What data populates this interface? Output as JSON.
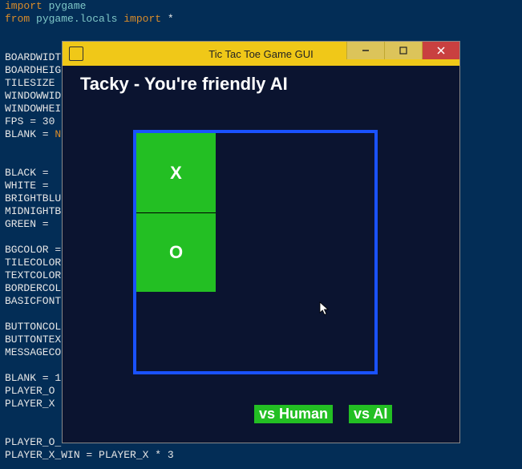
{
  "code_lines": [
    {
      "spans": [
        {
          "t": "import",
          "c": "kw-orange"
        },
        {
          "t": " pygame",
          "c": "kw-cyan"
        }
      ]
    },
    {
      "spans": [
        {
          "t": "from",
          "c": "kw-orange"
        },
        {
          "t": " pygame.locals ",
          "c": "kw-cyan"
        },
        {
          "t": "import",
          "c": "kw-orange"
        },
        {
          "t": " *",
          "c": "kw-white"
        }
      ]
    },
    {
      "spans": []
    },
    {
      "spans": []
    },
    {
      "spans": [
        {
          "t": "BOARDWIDT",
          "c": "kw-white"
        }
      ]
    },
    {
      "spans": [
        {
          "t": "BOARDHEIG",
          "c": "kw-white"
        }
      ]
    },
    {
      "spans": [
        {
          "t": "TILESIZE ",
          "c": "kw-white"
        }
      ]
    },
    {
      "spans": [
        {
          "t": "WINDOWWID",
          "c": "kw-white"
        }
      ]
    },
    {
      "spans": [
        {
          "t": "WINDOWHEI",
          "c": "kw-white"
        }
      ]
    },
    {
      "spans": [
        {
          "t": "FPS = 30",
          "c": "kw-white"
        }
      ]
    },
    {
      "spans": [
        {
          "t": "BLANK = ",
          "c": "kw-white"
        },
        {
          "t": "N",
          "c": "kw-orange"
        }
      ]
    },
    {
      "spans": []
    },
    {
      "spans": []
    },
    {
      "spans": [
        {
          "t": "BLACK = ",
          "c": "kw-white"
        }
      ]
    },
    {
      "spans": [
        {
          "t": "WHITE = ",
          "c": "kw-white"
        }
      ]
    },
    {
      "spans": [
        {
          "t": "BRIGHTBLU",
          "c": "kw-white"
        }
      ]
    },
    {
      "spans": [
        {
          "t": "MIDNIGHTB",
          "c": "kw-white"
        }
      ]
    },
    {
      "spans": [
        {
          "t": "GREEN = ",
          "c": "kw-white"
        }
      ]
    },
    {
      "spans": []
    },
    {
      "spans": [
        {
          "t": "BGCOLOR =",
          "c": "kw-white"
        }
      ]
    },
    {
      "spans": [
        {
          "t": "TILECOLOR",
          "c": "kw-white"
        }
      ]
    },
    {
      "spans": [
        {
          "t": "TEXTCOLOR",
          "c": "kw-white"
        }
      ]
    },
    {
      "spans": [
        {
          "t": "BORDERCOL",
          "c": "kw-white"
        }
      ]
    },
    {
      "spans": [
        {
          "t": "BASICFONT",
          "c": "kw-white"
        }
      ]
    },
    {
      "spans": []
    },
    {
      "spans": [
        {
          "t": "BUTTONCOL",
          "c": "kw-white"
        }
      ]
    },
    {
      "spans": [
        {
          "t": "BUTTONTEX",
          "c": "kw-white"
        }
      ]
    },
    {
      "spans": [
        {
          "t": "MESSAGECO",
          "c": "kw-white"
        }
      ]
    },
    {
      "spans": []
    },
    {
      "spans": [
        {
          "t": "BLANK = 1",
          "c": "kw-white"
        }
      ]
    },
    {
      "spans": [
        {
          "t": "PLAYER_O ",
          "c": "kw-white"
        }
      ]
    },
    {
      "spans": [
        {
          "t": "PLAYER_X ",
          "c": "kw-white"
        }
      ]
    },
    {
      "spans": []
    },
    {
      "spans": []
    },
    {
      "spans": [
        {
          "t": "PLAYER_O_",
          "c": "kw-white"
        }
      ]
    },
    {
      "spans": [
        {
          "t": "PLAYER_X_WIN = PLAYER_X * 3",
          "c": "kw-white"
        }
      ]
    }
  ],
  "window": {
    "title": "Tic Tac Toe Game GUI"
  },
  "game": {
    "heading": "Tacky - You're friendly AI",
    "board": [
      [
        "X",
        "",
        ""
      ],
      [
        "O",
        "",
        ""
      ],
      [
        "",
        "",
        ""
      ]
    ],
    "mode_human_label": "vs Human",
    "mode_ai_label": "vs AI"
  }
}
